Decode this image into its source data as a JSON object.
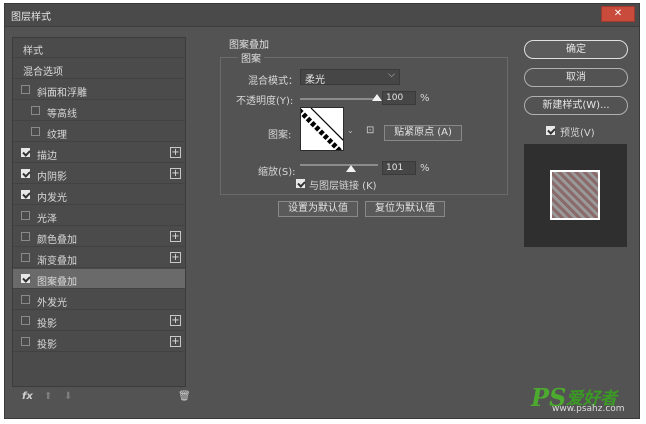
{
  "window": {
    "title": "图层样式",
    "close_label": "✕"
  },
  "styles_list": [
    {
      "label": "样式",
      "checkbox": false,
      "checked": false,
      "plus": false,
      "selected": false,
      "indent": 0
    },
    {
      "label": "混合选项",
      "checkbox": false,
      "checked": false,
      "plus": false,
      "selected": false,
      "indent": 0
    },
    {
      "label": "斜面和浮雕",
      "checkbox": true,
      "checked": false,
      "plus": false,
      "selected": false,
      "indent": 0
    },
    {
      "label": "等高线",
      "checkbox": true,
      "checked": false,
      "plus": false,
      "selected": false,
      "indent": 1
    },
    {
      "label": "纹理",
      "checkbox": true,
      "checked": false,
      "plus": false,
      "selected": false,
      "indent": 1
    },
    {
      "label": "描边",
      "checkbox": true,
      "checked": true,
      "plus": true,
      "selected": false,
      "indent": 0
    },
    {
      "label": "内阴影",
      "checkbox": true,
      "checked": true,
      "plus": true,
      "selected": false,
      "indent": 0
    },
    {
      "label": "内发光",
      "checkbox": true,
      "checked": true,
      "plus": false,
      "selected": false,
      "indent": 0
    },
    {
      "label": "光泽",
      "checkbox": true,
      "checked": false,
      "plus": false,
      "selected": false,
      "indent": 0
    },
    {
      "label": "颜色叠加",
      "checkbox": true,
      "checked": false,
      "plus": true,
      "selected": false,
      "indent": 0
    },
    {
      "label": "渐变叠加",
      "checkbox": true,
      "checked": false,
      "plus": true,
      "selected": false,
      "indent": 0
    },
    {
      "label": "图案叠加",
      "checkbox": true,
      "checked": true,
      "plus": false,
      "selected": true,
      "indent": 0
    },
    {
      "label": "外发光",
      "checkbox": true,
      "checked": false,
      "plus": false,
      "selected": false,
      "indent": 0
    },
    {
      "label": "投影",
      "checkbox": true,
      "checked": false,
      "plus": true,
      "selected": false,
      "indent": 0
    },
    {
      "label": "投影",
      "checkbox": true,
      "checked": false,
      "plus": true,
      "selected": false,
      "indent": 0
    }
  ],
  "bottom_bar": {
    "fx_label": "fx",
    "up_label": "⬆",
    "down_label": "⬇",
    "trash_label": "🗑"
  },
  "panel": {
    "section_title": "图案叠加",
    "group_title": "图案",
    "blend_mode_label": "混合模式：",
    "blend_mode_value": "柔光",
    "opacity_label": "不透明度(Y):",
    "opacity_value": "100",
    "opacity_unit": "%",
    "pattern_label": "图案:",
    "snap_origin_label": "贴紧原点 (A)",
    "scale_label": "缩放(S):",
    "scale_value": "101",
    "scale_unit": "%",
    "link_label": "与图层链接 (K)",
    "link_checked": true,
    "set_default_label": "设置为默认值",
    "reset_default_label": "复位为默认值"
  },
  "right_buttons": {
    "ok_label": "确定",
    "cancel_label": "取消",
    "new_style_label": "新建样式(W)...",
    "preview_label": "预览(V)",
    "preview_checked": true
  },
  "watermark": {
    "ps": "PS",
    "cn": "爱好者",
    "url": "www.psahz.com"
  },
  "colors": {
    "dialog_bg": "#535353",
    "selected_row": "#6a6a6a",
    "close_red": "#c84b3c",
    "watermark_green": "#4caa2e"
  }
}
